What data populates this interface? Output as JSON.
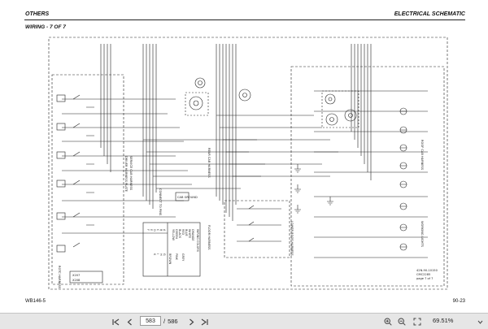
{
  "header": {
    "left": "OTHERS",
    "right": "ELECTRICAL SCHEMATIC",
    "subtitle": "WIRING - 7 OF 7"
  },
  "footer": {
    "left": "WB146-5",
    "right": "90-23"
  },
  "diagram": {
    "labels": {
      "driver_harness": "DRIVER HARNESS PLATE",
      "cab_harness": "SERVICE CAB HARNESS",
      "cab_note": "CONNECT TO PINS",
      "roof_harness": "ROOF CAB HARNESS",
      "cab_ground": "CAB GROUND",
      "floor_harness": "FLOOR HARNESS",
      "lower_harness": "LOWER ROOF HARNESS",
      "wiring_colors": "WIRING COLORS",
      "rear_harness": "REAR CAB HARNESS",
      "working_lights": "WORKING LIGHTS",
      "rotc_harness": "ROTC HARNESS",
      "connector_a": "X207",
      "connector_b": "X208",
      "ref": "42N-90-10150",
      "ref2": "CMC2285",
      "page_note": "page 7 of 7"
    },
    "color_legend": {
      "codes": [
        "A",
        "B",
        "C",
        "D",
        "E",
        "F",
        "G",
        "H",
        "I",
        "K"
      ],
      "names": [
        "ORANGE",
        "WHITE",
        "BLUE",
        "RED",
        "BLACK",
        "GREEN",
        "YELLOW",
        "BROWN",
        "PINK",
        "GREY"
      ]
    }
  },
  "toolbar": {
    "current_page": "583",
    "page_sep": "/",
    "total_pages": "586",
    "zoom": "69.51%"
  }
}
